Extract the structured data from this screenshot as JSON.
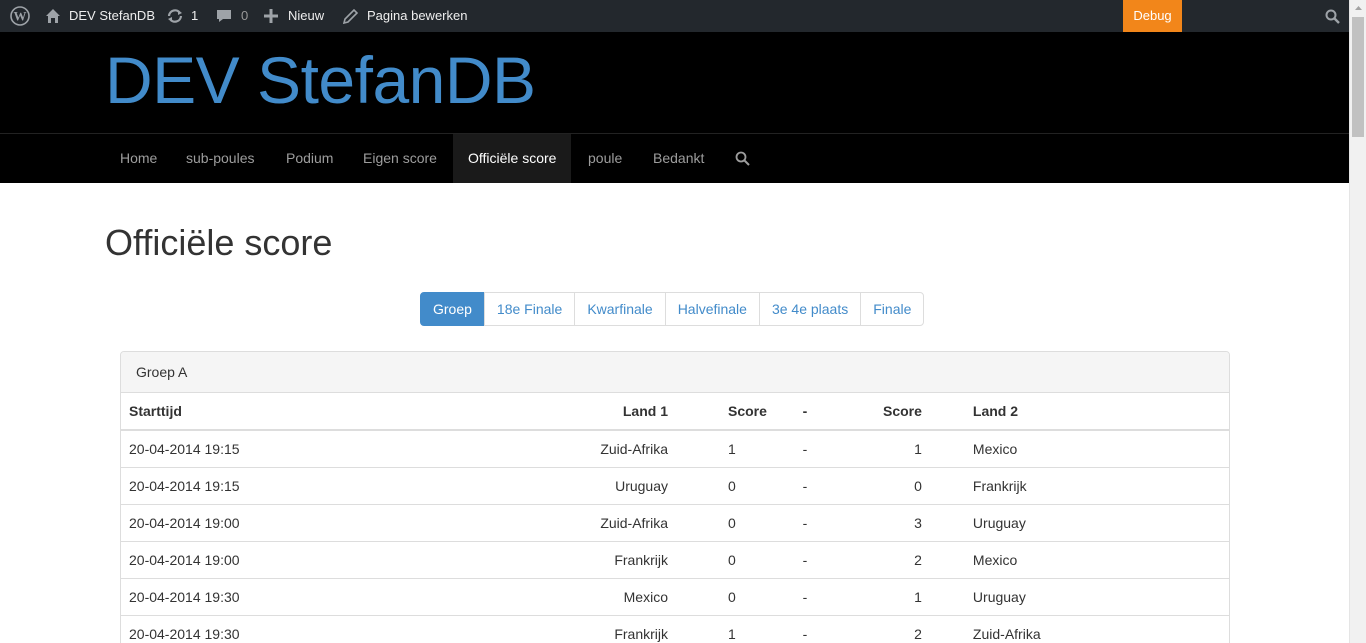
{
  "adminbar": {
    "site_name": "DEV StefanDB",
    "updates_count": "1",
    "comments_count": "0",
    "new_label": "Nieuw",
    "edit_label": "Pagina bewerken",
    "debug_label": "Debug"
  },
  "header": {
    "site_title": "DEV StefanDB"
  },
  "nav": {
    "items": [
      {
        "label": "Home"
      },
      {
        "label": "sub-poules"
      },
      {
        "label": "Podium"
      },
      {
        "label": "Eigen score"
      },
      {
        "label": "Officiële score"
      },
      {
        "label": "poule"
      },
      {
        "label": "Bedankt"
      }
    ],
    "active": "Officiële score"
  },
  "page": {
    "title": "Officiële score"
  },
  "tabs": {
    "items": [
      "Groep",
      "18e Finale",
      "Kwarfinale",
      "Halvefinale",
      "3e 4e plaats",
      "Finale"
    ],
    "active": "Groep"
  },
  "panel": {
    "heading": "Groep A",
    "columns": [
      "Starttijd",
      "Land 1",
      "Score",
      "-",
      "Score",
      "Land 2"
    ],
    "rows": [
      {
        "start": "20-04-2014 19:15",
        "land1": "Zuid-Afrika",
        "score1": "1",
        "dash": "-",
        "score2": "1",
        "land2": "Mexico"
      },
      {
        "start": "20-04-2014 19:15",
        "land1": "Uruguay",
        "score1": "0",
        "dash": "-",
        "score2": "0",
        "land2": "Frankrijk"
      },
      {
        "start": "20-04-2014 19:00",
        "land1": "Zuid-Afrika",
        "score1": "0",
        "dash": "-",
        "score2": "3",
        "land2": "Uruguay"
      },
      {
        "start": "20-04-2014 19:00",
        "land1": "Frankrijk",
        "score1": "0",
        "dash": "-",
        "score2": "2",
        "land2": "Mexico"
      },
      {
        "start": "20-04-2014 19:30",
        "land1": "Mexico",
        "score1": "0",
        "dash": "-",
        "score2": "1",
        "land2": "Uruguay"
      },
      {
        "start": "20-04-2014 19:30",
        "land1": "Frankrijk",
        "score1": "1",
        "dash": "-",
        "score2": "2",
        "land2": "Zuid-Afrika"
      }
    ]
  },
  "colors": {
    "adminbar_bg": "#23282d",
    "debug_bg": "#f2861a",
    "link": "#428bca",
    "header_bg": "#000000"
  }
}
